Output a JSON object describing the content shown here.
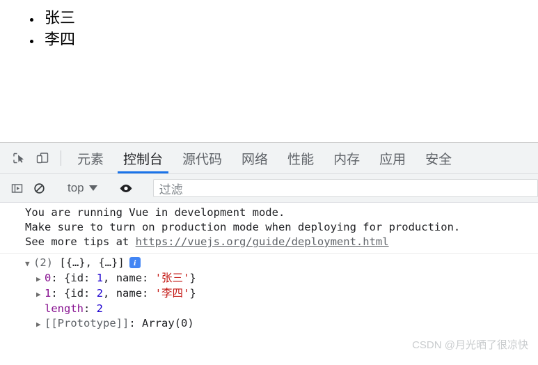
{
  "page": {
    "list_items": [
      "张三",
      "李四"
    ]
  },
  "devtools": {
    "icons": {
      "inspect": "inspect-element-icon",
      "device": "device-toolbar-icon"
    },
    "tabs": [
      {
        "label": "元素",
        "active": false
      },
      {
        "label": "控制台",
        "active": true
      },
      {
        "label": "源代码",
        "active": false
      },
      {
        "label": "网络",
        "active": false
      },
      {
        "label": "性能",
        "active": false
      },
      {
        "label": "内存",
        "active": false
      },
      {
        "label": "应用",
        "active": false
      },
      {
        "label": "安全",
        "active": false
      }
    ],
    "console_toolbar": {
      "sidebar_icon": "console-sidebar-icon",
      "clear_icon": "clear-console-icon",
      "context": "top",
      "eye_icon": "live-expression-icon",
      "filter_placeholder": "过滤"
    },
    "console": {
      "messages": [
        "You are running Vue in development mode.",
        "Make sure to turn on production mode when deploying for production.",
        "See more tips at "
      ],
      "link": "https://vuejs.org/guide/deployment.html",
      "array": {
        "count_label": "(2)",
        "preview": "[{…}, {…}]",
        "info_badge": "i",
        "rows": [
          {
            "index": "0",
            "open": "{",
            "key1": "id",
            "num": "1",
            "key2": "name",
            "str": "'张三'",
            "close": "}"
          },
          {
            "index": "1",
            "open": "{",
            "key1": "id",
            "num": "2",
            "key2": "name",
            "str": "'李四'",
            "close": "}"
          }
        ],
        "length_key": "length",
        "length_value": "2",
        "prototype_key": "[[Prototype]]",
        "prototype_value": "Array(0)"
      }
    },
    "watermark": "CSDN @月光晒了很凉快"
  },
  "colors": {
    "accent": "#1a73e8",
    "info_badge": "#4285f4",
    "string": "#c41a16",
    "number": "#1c00cf",
    "key": "#881391"
  }
}
